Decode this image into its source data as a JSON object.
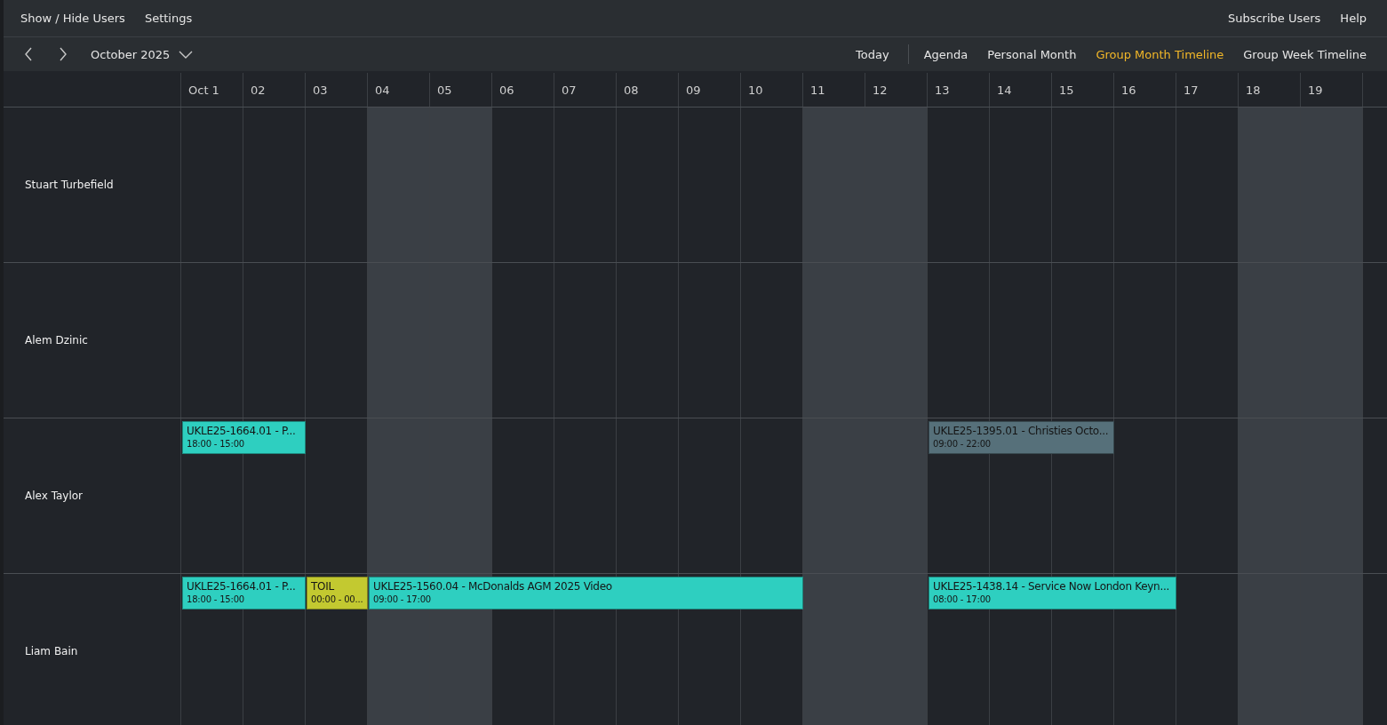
{
  "top_menu": {
    "left": [
      "Show / Hide Users",
      "Settings"
    ],
    "right": [
      "Subscribe Users",
      "Help"
    ]
  },
  "toolbar": {
    "period": "October 2025",
    "today": "Today",
    "views": [
      {
        "label": "Agenda",
        "selected": false
      },
      {
        "label": "Personal Month",
        "selected": false
      },
      {
        "label": "Group Month Timeline",
        "selected": true
      },
      {
        "label": "Group Week Timeline",
        "selected": false
      }
    ]
  },
  "days": [
    {
      "label": "Oct 1",
      "weekend": false
    },
    {
      "label": "02",
      "weekend": false
    },
    {
      "label": "03",
      "weekend": false
    },
    {
      "label": "04",
      "weekend": true
    },
    {
      "label": "05",
      "weekend": true
    },
    {
      "label": "06",
      "weekend": false
    },
    {
      "label": "07",
      "weekend": false
    },
    {
      "label": "08",
      "weekend": false
    },
    {
      "label": "09",
      "weekend": false
    },
    {
      "label": "10",
      "weekend": false
    },
    {
      "label": "11",
      "weekend": true
    },
    {
      "label": "12",
      "weekend": true
    },
    {
      "label": "13",
      "weekend": false
    },
    {
      "label": "14",
      "weekend": false
    },
    {
      "label": "15",
      "weekend": false
    },
    {
      "label": "16",
      "weekend": false
    },
    {
      "label": "17",
      "weekend": false
    },
    {
      "label": "18",
      "weekend": true
    },
    {
      "label": "19",
      "weekend": true
    }
  ],
  "users": [
    {
      "name": "Stuart Turbefield"
    },
    {
      "name": "Alem Dzinic"
    },
    {
      "name": "Alex Taylor",
      "slots": [
        {
          "kind": "event",
          "title": "UKLE25-1664.01 - P...",
          "time": "18:00 - 15:00",
          "color": "#2ecfc0"
        },
        {
          "kind": "continued"
        },
        {
          "kind": "empty"
        },
        {
          "kind": "empty"
        },
        {
          "kind": "empty"
        },
        {
          "kind": "empty"
        },
        {
          "kind": "empty"
        },
        {
          "kind": "empty"
        },
        {
          "kind": "empty"
        },
        {
          "kind": "empty"
        },
        {
          "kind": "empty"
        },
        {
          "kind": "empty"
        },
        {
          "kind": "event",
          "title": "UKLE25-1395.01 - Christies Octo...",
          "time": "09:00 - 22:00",
          "color": "#56707a"
        },
        {
          "kind": "continued"
        },
        {
          "kind": "continued"
        }
      ]
    },
    {
      "name": "Liam Bain",
      "slots": [
        {
          "kind": "event",
          "title": "UKLE25-1664.01 - P...",
          "time": "18:00 - 15:00",
          "color": "#2ecfc0"
        },
        {
          "kind": "continued"
        },
        {
          "kind": "event",
          "title": "TOIL",
          "time": "00:00 - 00...",
          "color": "#c3c930"
        },
        {
          "kind": "event",
          "title": "UKLE25-1560.04 - McDonalds AGM 2025 Video",
          "time": "09:00 - 17:00",
          "color": "#2ecfc0"
        },
        {
          "kind": "continued"
        },
        {
          "kind": "continued"
        },
        {
          "kind": "continued"
        },
        {
          "kind": "continued"
        },
        {
          "kind": "continued"
        },
        {
          "kind": "continued"
        },
        {
          "kind": "empty"
        },
        {
          "kind": "empty"
        },
        {
          "kind": "event",
          "title": "UKLE25-1438.14 - Service Now London Keyn...",
          "time": "08:00 - 17:00",
          "color": "#2ecfc0"
        },
        {
          "kind": "continued"
        },
        {
          "kind": "continued"
        },
        {
          "kind": "continued"
        }
      ]
    }
  ]
}
